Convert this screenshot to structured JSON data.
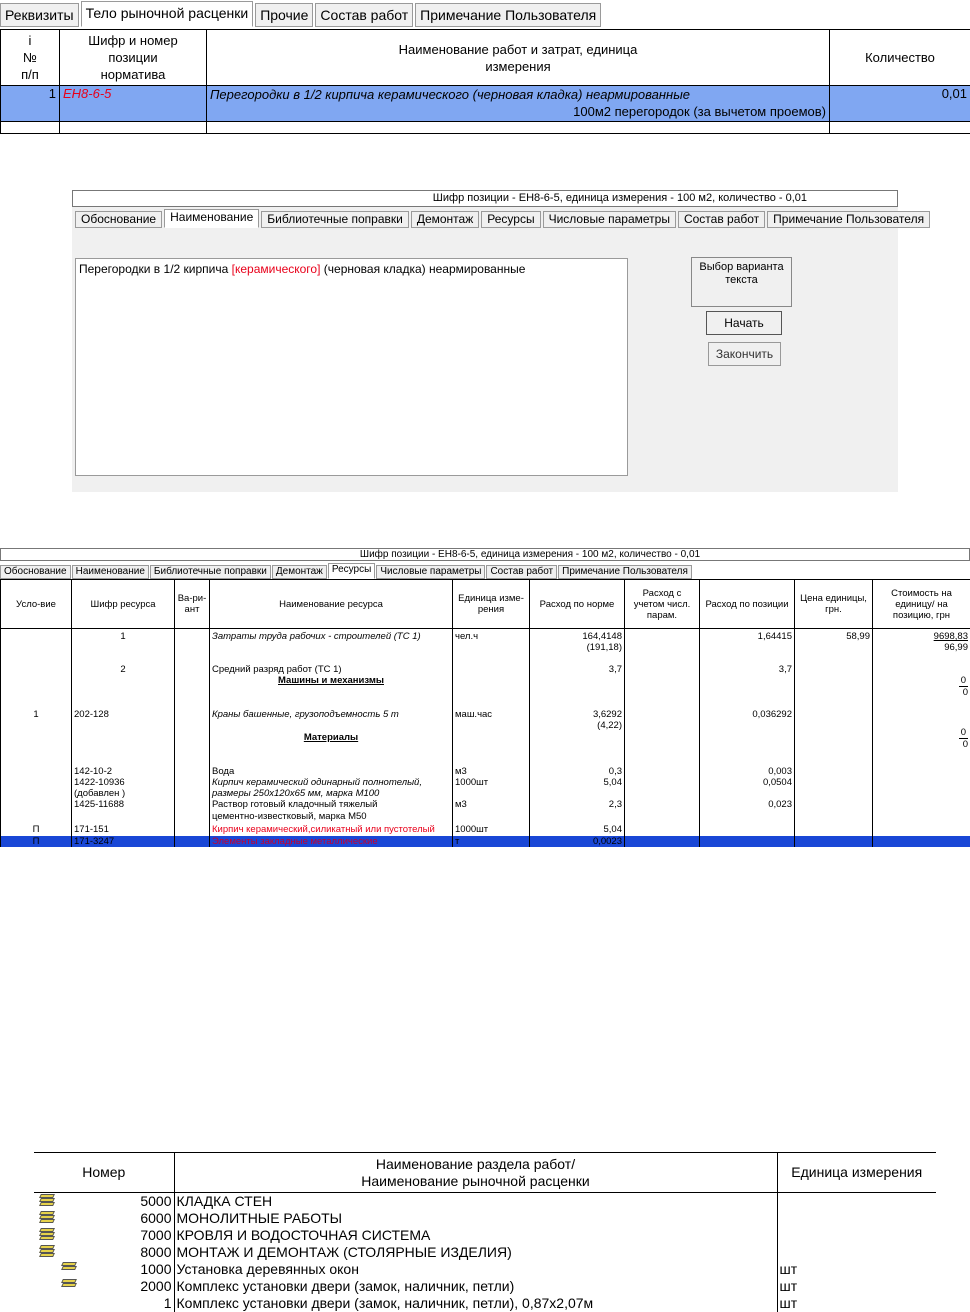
{
  "panel1": {
    "tabs": [
      {
        "label": "Реквизиты",
        "active": false
      },
      {
        "label": "Тело рыночной расценки",
        "active": true
      },
      {
        "label": "Прочие",
        "active": false
      },
      {
        "label": "Состав работ",
        "active": false
      },
      {
        "label": "Примечание Пользователя",
        "active": false
      }
    ],
    "headers": {
      "num": [
        "i",
        "№",
        "п/п"
      ],
      "code": [
        "Шифр и номер",
        "позиции",
        "норматива"
      ],
      "name": [
        "Наименование работ и затрат, единица",
        "измерения"
      ],
      "qty": "Количество"
    },
    "row": {
      "num": "1",
      "code": "ЕН8-6-5",
      "name": "Перегородки в 1/2 кирпича керамического (черновая кладка) неармированные",
      "unit": "100м2 перегородок (за вычетом проемов)",
      "qty": "0,01"
    }
  },
  "panel2": {
    "header": "Шифр позиции - ЕН8-6-5, единица измерения - 100 м2, количество - 0,01",
    "tabs": [
      {
        "label": "Обоснование",
        "active": false
      },
      {
        "label": "Наименование",
        "active": true
      },
      {
        "label": "Библиотечные поправки",
        "active": false
      },
      {
        "label": "Демонтаж",
        "active": false
      },
      {
        "label": "Ресурсы",
        "active": false
      },
      {
        "label": "Числовые параметры",
        "active": false
      },
      {
        "label": "Состав работ",
        "active": false
      },
      {
        "label": "Примечание Пользователя",
        "active": false
      }
    ],
    "text_before": "Перегородки в 1/2 кирпича ",
    "text_highlight": "[керамического]",
    "text_after": " (черновая кладка) неармированные",
    "variant_label": "Выбор варианта текста",
    "start_button": "Начать",
    "stop_button": "Закончить"
  },
  "panel3": {
    "header": "Шифр позиции - ЕН8-6-5, единица измерения - 100 м2, количество - 0,01",
    "tabs": [
      {
        "label": "Обоснование",
        "active": false
      },
      {
        "label": "Наименование",
        "active": false
      },
      {
        "label": "Библиотечные поправки",
        "active": false
      },
      {
        "label": "Демонтаж",
        "active": false
      },
      {
        "label": "Ресурсы",
        "active": true
      },
      {
        "label": "Числовые параметры",
        "active": false
      },
      {
        "label": "Состав работ",
        "active": false
      },
      {
        "label": "Примечание Пользователя",
        "active": false
      }
    ],
    "columns": [
      "Усло-вие",
      "Шифр ресурса",
      "Ва-ри-ант",
      "Наименование ресурса",
      "Единица изме-рения",
      "Расход по норме",
      "Расход с учетом числ. парам.",
      "Расход по позиции",
      "Цена единицы, грн.",
      "Стоимость на единицу/ на позицию, грн"
    ],
    "labor": {
      "code": "1",
      "name": "Затраты труда рабочих - строителей (ТС 1)",
      "unit": "чел.ч",
      "norm": "164,4148",
      "norm2": "(191,18)",
      "pos": "1,64415",
      "price": "58,99",
      "cost": "9698,83",
      "cost2": "96,99"
    },
    "grade": {
      "code": "2",
      "name": "Средний разряд работ (ТС 1)",
      "norm": "3,7",
      "pos": "3,7"
    },
    "machines_title": "Машины и механизмы",
    "machines_cost": "0",
    "machines_cost2": "0",
    "crane": {
      "cond": "1",
      "code": "202-128",
      "name": "Краны башенные, грузоподъемность 5 т",
      "unit": "маш.час",
      "norm": "3,6292",
      "norm2": "(4,22)",
      "pos": "0,036292"
    },
    "materials_title": "Материалы",
    "materials_cost": "0",
    "materials_cost2": "0",
    "water": {
      "code": "142-10-2",
      "name": "Вода",
      "unit": "м3",
      "norm": "0,3",
      "pos": "0,003"
    },
    "brick": {
      "code": "1422-10936",
      "code2": "(добавлен )",
      "name": "Кирпич керамический одинарный полнотелый,",
      "name2": "размеры 250х120х65 мм, марка М100",
      "unit": "1000шт",
      "norm": "5,04",
      "pos": "0,0504"
    },
    "mortar": {
      "code": "1425-11688",
      "name": "Раствор готовый кладочный тяжелый",
      "name2": "цементно-известковый, марка М50",
      "unit": "м3",
      "norm": "2,3",
      "pos": "0,023"
    },
    "brick_red": {
      "cond": "П",
      "code": "171-151",
      "name": "Кирпич керамический,силикатный или пустотелый",
      "unit": "1000шт",
      "norm": "5,04"
    },
    "selected": {
      "cond": "П",
      "code": "171-3247",
      "name": "Элементы закладные металлические",
      "unit": "т",
      "norm": "0,0023"
    }
  },
  "panel4": {
    "headers": {
      "num": "Номер",
      "name": [
        "Наименование раздела работ/",
        "Наименование рыночной расценки"
      ],
      "unit": "Единица измерения"
    },
    "rows": [
      {
        "icon": "books-stack-icon",
        "level": 0,
        "num": "5000",
        "name": "КЛАДКА СТЕН",
        "unit": ""
      },
      {
        "icon": "books-stack-icon",
        "level": 0,
        "num": "6000",
        "name": "МОНОЛИТНЫЕ РАБОТЫ",
        "unit": ""
      },
      {
        "icon": "books-stack-icon",
        "level": 0,
        "num": "7000",
        "name": "КРОВЛЯ И ВОДОСТОЧНАЯ СИСТЕМА",
        "unit": ""
      },
      {
        "icon": "books-stack-icon",
        "level": 0,
        "num": "8000",
        "name": "МОНТАЖ И ДЕМОНТАЖ (СТОЛЯРНЫЕ ИЗДЕЛИЯ)",
        "unit": ""
      },
      {
        "icon": "books-pair-icon",
        "level": 1,
        "num": "1000",
        "name": "Установка деревянных окон",
        "unit": "шт"
      },
      {
        "icon": "books-pair-icon",
        "level": 1,
        "num": "2000",
        "name": "Комплекс установки двери (замок, наличник, петли)",
        "unit": "шт"
      },
      {
        "icon": "",
        "level": 2,
        "num": "1",
        "name": "Комплекс установки двери (замок, наличник, петли), 0,87х2,07м",
        "unit": "шт"
      }
    ]
  }
}
